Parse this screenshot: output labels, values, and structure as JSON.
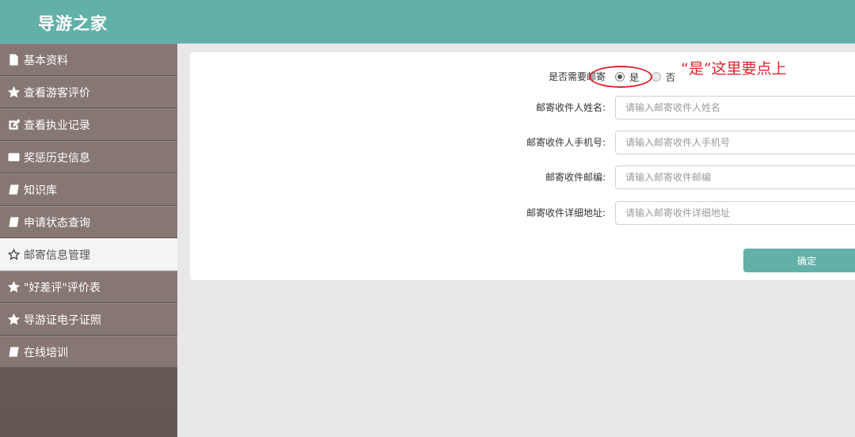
{
  "header": {
    "title": "导游之家",
    "bg_color": "#62b1a8"
  },
  "sidebar": {
    "items": [
      {
        "label": "基本资料",
        "icon": "document-icon"
      },
      {
        "label": "查看游客评价",
        "icon": "star-icon"
      },
      {
        "label": "查看执业记录",
        "icon": "edit-icon"
      },
      {
        "label": "奖惩历史信息",
        "icon": "id-card-icon"
      },
      {
        "label": "知识库",
        "icon": "book-icon"
      },
      {
        "label": "申请状态查询",
        "icon": "book-icon"
      },
      {
        "label": "邮寄信息管理",
        "icon": "star-outline-icon",
        "active": true
      },
      {
        "label": "\"好差评\"评价表",
        "icon": "star-icon"
      },
      {
        "label": "导游证电子证照",
        "icon": "star-icon"
      },
      {
        "label": "在线培训",
        "icon": "book-icon"
      }
    ]
  },
  "form": {
    "mail_required": {
      "label": "是否需要邮寄",
      "options": [
        "是",
        "否"
      ],
      "selected": "是"
    },
    "fields": [
      {
        "label": "邮寄收件人姓名:",
        "placeholder": "请输入邮寄收件人姓名",
        "value": ""
      },
      {
        "label": "邮寄收件人手机号:",
        "placeholder": "请输入邮寄收件人手机号",
        "value": ""
      },
      {
        "label": "邮寄收件邮编:",
        "placeholder": "请输入邮寄收件邮编",
        "value": ""
      },
      {
        "label": "邮寄收件详细地址:",
        "placeholder": "请输入邮寄收件详细地址",
        "value": ""
      }
    ],
    "submit_label": "确定"
  },
  "annotation": {
    "text": "“是”这里要点上",
    "color": "#e0242c"
  }
}
